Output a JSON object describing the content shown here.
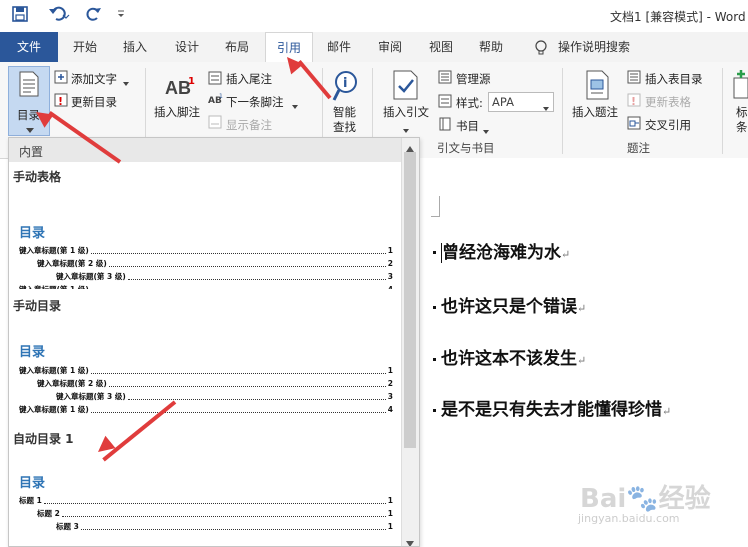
{
  "title_bar": {
    "doc_title": "文档1 [兼容模式] - Word",
    "save_icon": "save-icon",
    "undo_icon": "undo-icon",
    "redo_icon": "redo-icon",
    "customize_icon": "customize-icon"
  },
  "tabs": [
    {
      "label": "文件"
    },
    {
      "label": "开始"
    },
    {
      "label": "插入"
    },
    {
      "label": "设计"
    },
    {
      "label": "布局"
    },
    {
      "label": "引用"
    },
    {
      "label": "邮件"
    },
    {
      "label": "审阅"
    },
    {
      "label": "视图"
    },
    {
      "label": "帮助"
    },
    {
      "label": "操作说明搜索"
    }
  ],
  "ribbon": {
    "toc_button": "目录",
    "add_text": "添加文字",
    "update_toc": "更新目录",
    "insert_footnote": "插入脚注",
    "insert_endnote": "插入尾注",
    "next_footnote": "下一条脚注",
    "show_notes": "显示备注",
    "smart_lookup": "智能\n查找",
    "smart_lookup_1": "智能",
    "smart_lookup_2": "查找",
    "insert_citation": "插入引文",
    "manage_sources": "管理源",
    "style_label": "样式:",
    "style_value": "APA",
    "bibliography": "书目",
    "group_citations": "引文与书目",
    "insert_caption": "插入题注",
    "insert_table_of_figures": "插入表目录",
    "update_table": "更新表格",
    "cross_reference": "交叉引用",
    "group_captions": "题注",
    "mark_entry_1": "标",
    "mark_entry_2": "条"
  },
  "toc_gallery": {
    "header": "内置",
    "sections": [
      {
        "title": "手动表格",
        "toc_title": "目录",
        "lines": [
          {
            "text": "键入章标题(第 1 级)",
            "page": "1"
          },
          {
            "text": "键入章标题(第 2 级)",
            "page": "2"
          },
          {
            "text": "键入章标题(第 3 级)",
            "page": "3"
          },
          {
            "text": "键入章标题(第 1 级)",
            "page": "4"
          }
        ]
      },
      {
        "title": "手动目录",
        "toc_title": "目录",
        "lines": [
          {
            "text": "键入章标题(第 1 级)",
            "page": "1"
          },
          {
            "text": "键入章标题(第 2 级)",
            "page": "2"
          },
          {
            "text": "键入章标题(第 3 级)",
            "page": "3"
          },
          {
            "text": "键入章标题(第 1 级)",
            "page": "4"
          }
        ]
      },
      {
        "title": "自动目录 1",
        "toc_title": "目录",
        "lines": [
          {
            "text": "标题 1",
            "page": "1"
          },
          {
            "text": "标题 2",
            "page": "1"
          },
          {
            "text": "标题 3",
            "page": "1"
          }
        ]
      }
    ]
  },
  "document": {
    "paragraphs": [
      "曾经沧海难为水",
      "也许这只是个错误",
      "也许这本不该发生",
      "是不是只有失去才能懂得珍惜"
    ],
    "para_mark": "↵"
  },
  "colors": {
    "accent": "#2b579a",
    "toc_heading": "#2e74b5",
    "annotation_arrow": "#e03c3c"
  }
}
